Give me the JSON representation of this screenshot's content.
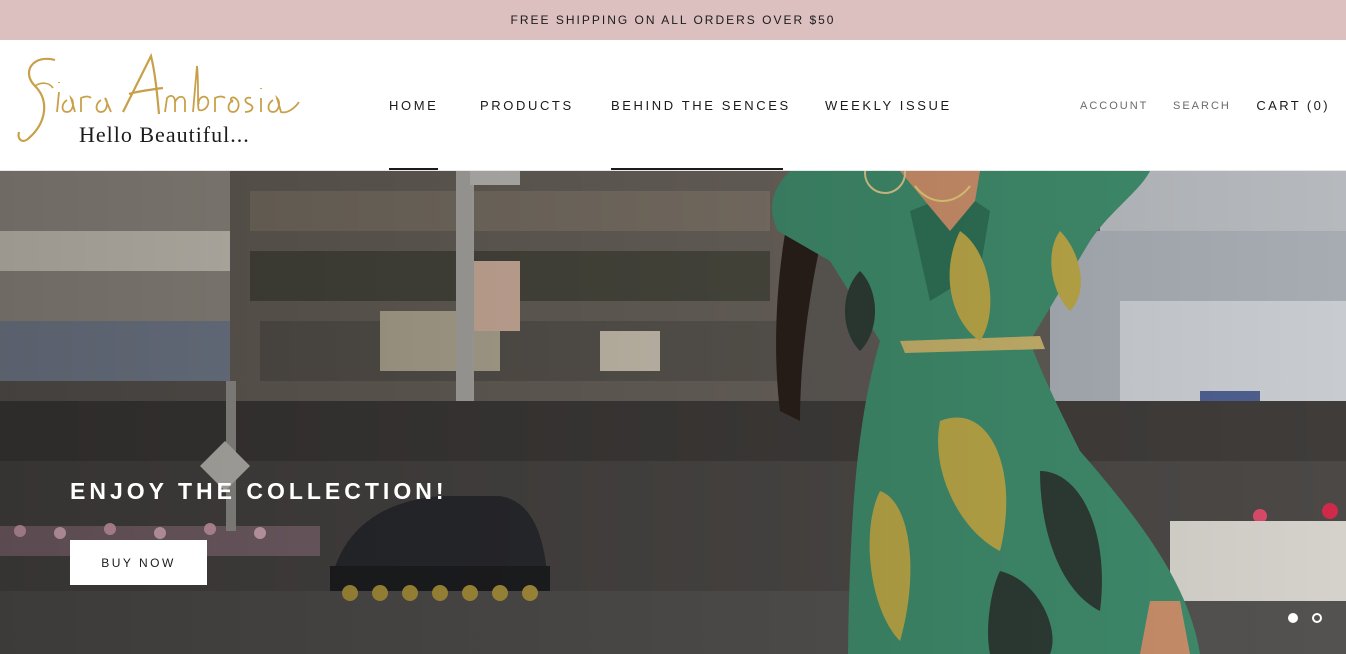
{
  "announcement": {
    "text": "FREE SHIPPING ON ALL ORDERS OVER $50"
  },
  "logo": {
    "script": "Siara Ambrosia",
    "tagline": "Hello Beautiful..."
  },
  "nav": {
    "items": [
      {
        "label": "HOME"
      },
      {
        "label": "PRODUCTS"
      },
      {
        "label": "BEHIND THE SENCES"
      },
      {
        "label": "WEEKLY ISSUE"
      }
    ]
  },
  "header_actions": {
    "account": "ACCOUNT",
    "search": "SEARCH",
    "cart": "CART (0)"
  },
  "hero": {
    "title": "ENJOY THE COLLECTION!",
    "button_label": "BUY NOW",
    "slide_count": 2,
    "active_slide": 1
  },
  "colors": {
    "announcement_bg": "#dcbfbf",
    "logo_gold": "#c9a04a",
    "text": "#1c1b1b",
    "dress_green": "#3f8a6b",
    "leaf_yellow": "#b8a647"
  }
}
